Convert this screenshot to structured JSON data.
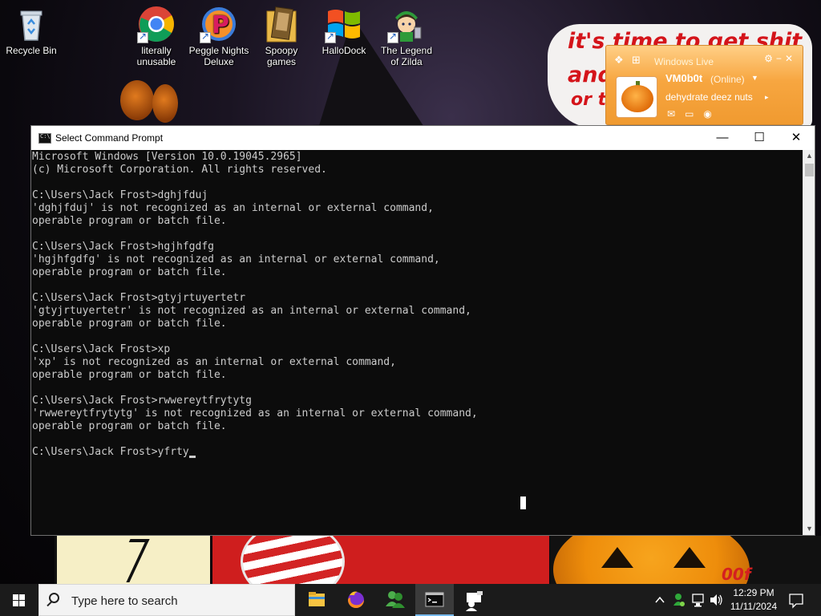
{
  "desktop": {
    "icons": [
      {
        "label": "Recycle Bin",
        "icon": "recycle-bin-icon"
      },
      {
        "label": "literally\nunusable",
        "icon": "chrome-icon"
      },
      {
        "label": "Peggle Nights\nDeluxe",
        "icon": "peggle-icon"
      },
      {
        "label": "Spoopy\ngames",
        "icon": "folder-games-icon"
      },
      {
        "label": "HalloDock",
        "icon": "windows-flag-icon"
      },
      {
        "label": "The Legend\nof Zilda",
        "icon": "zilda-character-icon"
      }
    ],
    "wallpaper_text": [
      "it's time to get shit",
      "and",
      "or t"
    ],
    "wallpaper_badge": "00f"
  },
  "messenger_alert": {
    "title": "Windows Live",
    "name": "VM0b0t",
    "status": "(Online)",
    "message": "dehydrate deez nuts",
    "colors": {
      "accent": "#f7a640"
    }
  },
  "cmd_window": {
    "title": "Select Command Prompt",
    "controls": {
      "minimize": "—",
      "maximize": "☐",
      "close": "✕"
    },
    "lines": [
      "Microsoft Windows [Version 10.0.19045.2965]",
      "(c) Microsoft Corporation. All rights reserved.",
      "",
      "C:\\Users\\Jack Frost>dghjfduj",
      "'dghjfduj' is not recognized as an internal or external command,",
      "operable program or batch file.",
      "",
      "C:\\Users\\Jack Frost>hgjhfgdfg",
      "'hgjhfgdfg' is not recognized as an internal or external command,",
      "operable program or batch file.",
      "",
      "C:\\Users\\Jack Frost>gtyjrtuyertetr",
      "'gtyjrtuyertetr' is not recognized as an internal or external command,",
      "operable program or batch file.",
      "",
      "C:\\Users\\Jack Frost>xp",
      "'xp' is not recognized as an internal or external command,",
      "operable program or batch file.",
      "",
      "C:\\Users\\Jack Frost>rwwereytfrytytg",
      "'rwwereytfrytytg' is not recognized as an internal or external command,",
      "operable program or batch file.",
      ""
    ],
    "prompt": "C:\\Users\\Jack Frost>",
    "current_input": "yfrty"
  },
  "taskbar": {
    "search_placeholder": "Type here to search",
    "apps": [
      "file-explorer-icon",
      "firefox-icon",
      "messenger-buddies-icon",
      "command-prompt-icon",
      "remote-desktop-icon"
    ],
    "tray_chevron": "^",
    "time": "12:29 PM",
    "date": "11/11/2024"
  }
}
